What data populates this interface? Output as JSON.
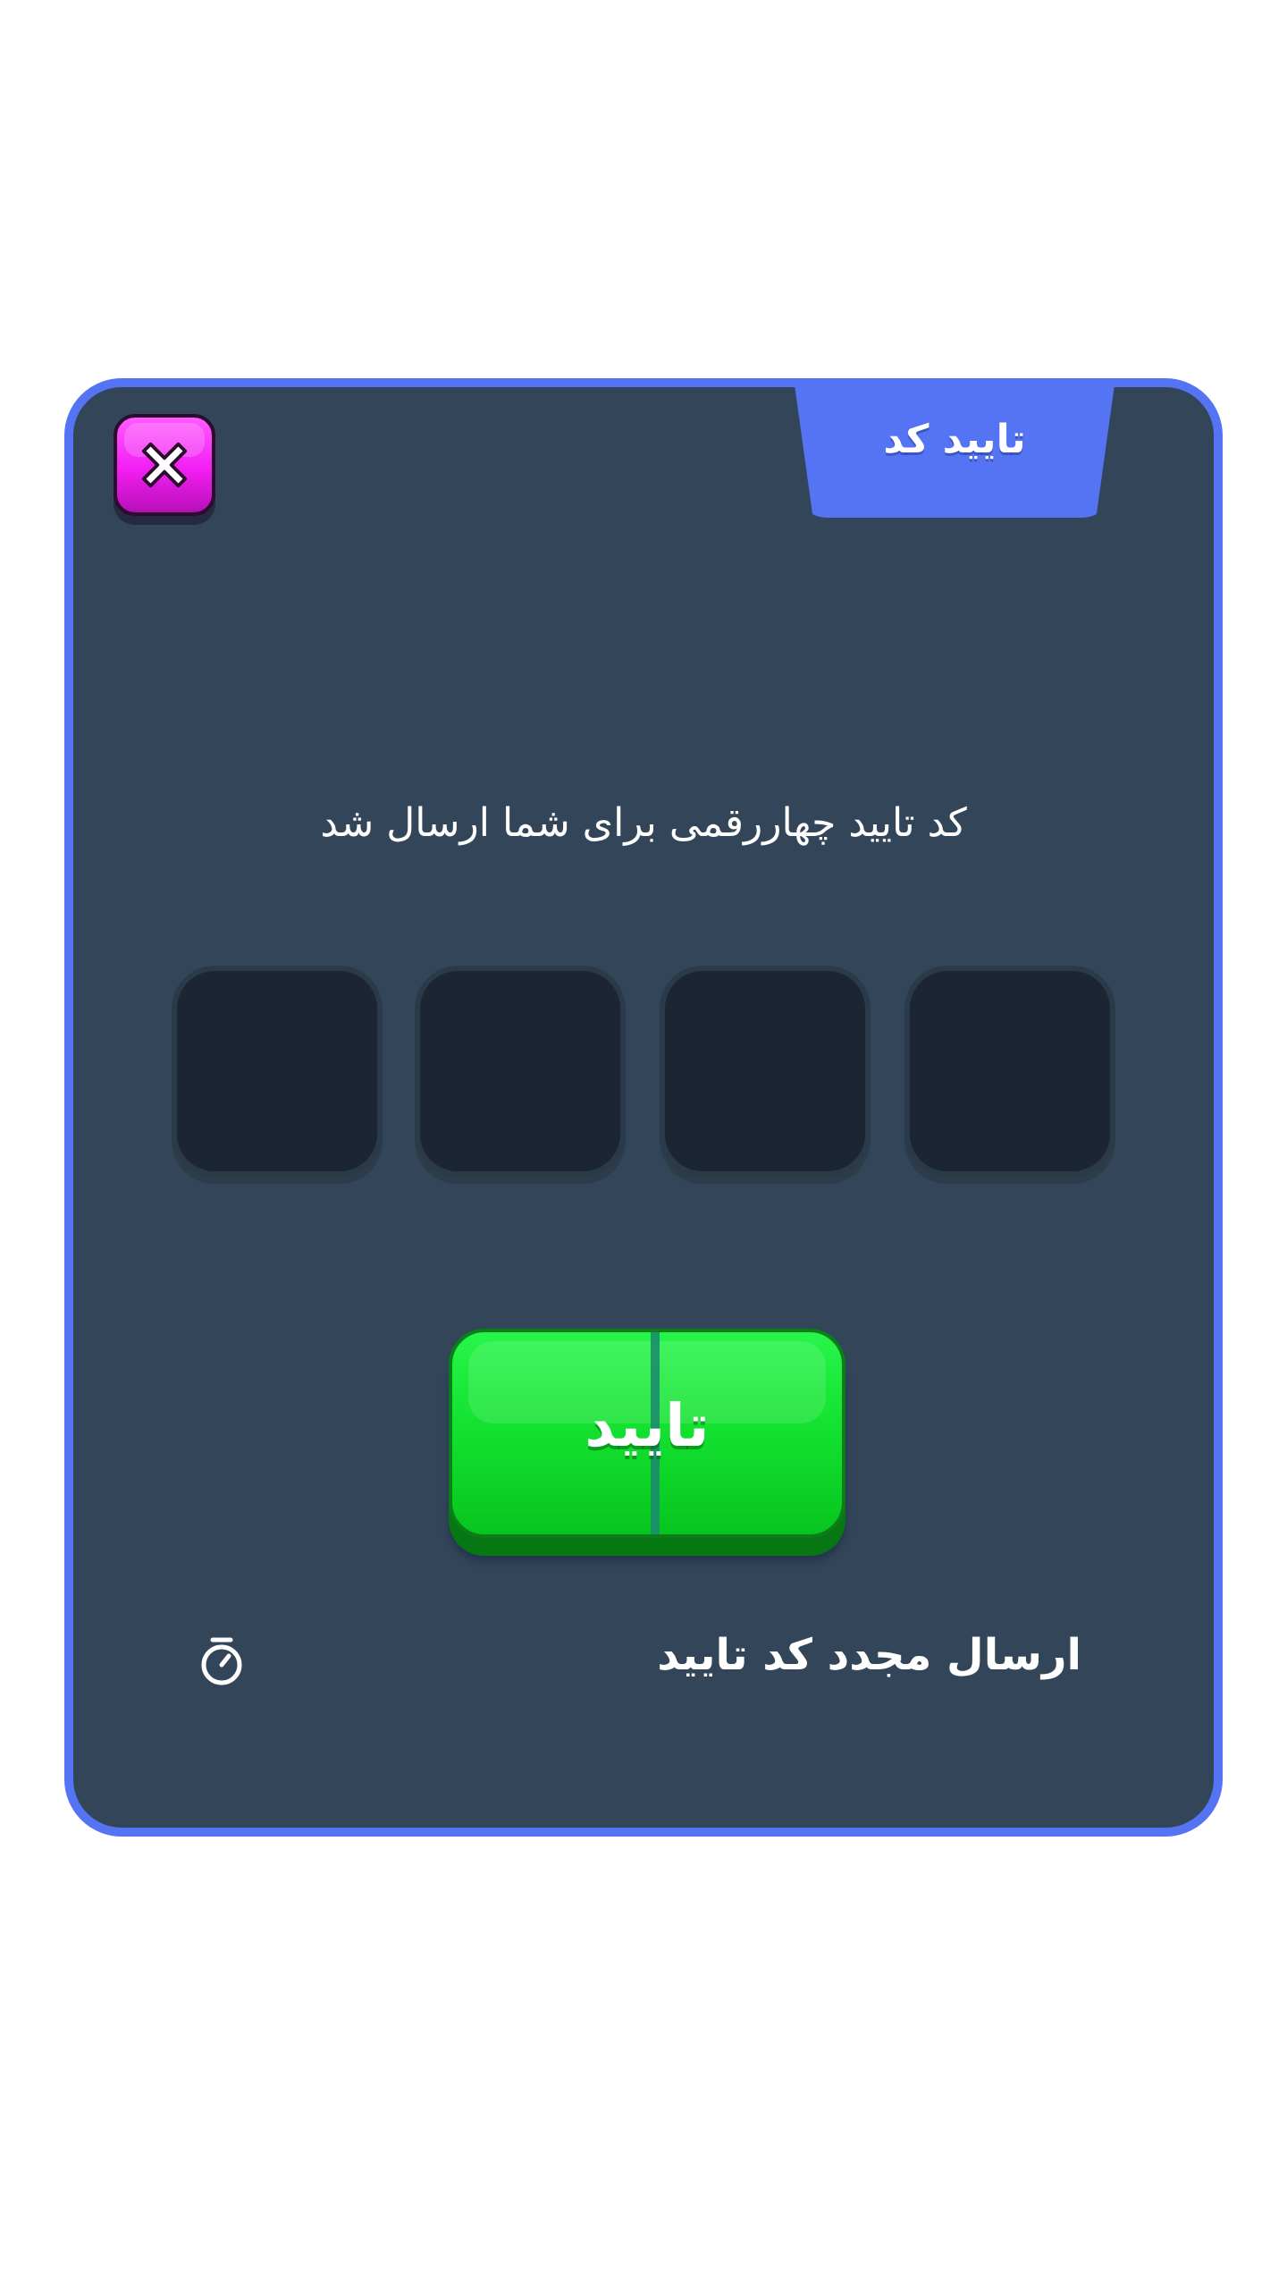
{
  "dialog": {
    "title": "تایید کد",
    "message": "کد تایید چهاررقمی برای شما ارسال شد",
    "code_inputs": [
      "",
      "",
      "",
      ""
    ],
    "confirm_label": "تایید",
    "resend_label": "ارسال مجدد کد تایید",
    "icons": {
      "close": "close-icon",
      "timer": "stopwatch-icon"
    },
    "colors": {
      "border": "#5474f4",
      "panel": "#334659",
      "confirm": "#12e02e",
      "close": "#f21ef2",
      "code_box": "#1b2534"
    }
  }
}
